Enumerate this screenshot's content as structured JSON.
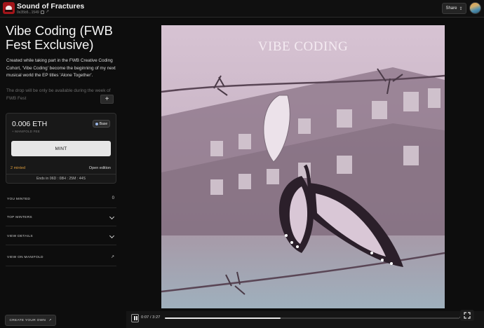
{
  "header": {
    "app_title": "Sound of Fractures",
    "address": "0x35b5...1549",
    "share_label": "Share"
  },
  "token": {
    "title": "Vibe Coding (FWB Fest Exclusive)",
    "description": "Created while taking part in the FWB Creative Coding Cohort, 'Vibe Coding' become the beginning of my next musical world the EP titles 'Alone Together'.",
    "description_more": "The drop will be only be available during the week of FWB Fest",
    "expand_label": "+"
  },
  "mint_card": {
    "price": "0.006 ETH",
    "fee_label": "+ MANIFOLD FEE",
    "chain": "Base",
    "mint_label": "MINT",
    "minted": "2 minted",
    "edition": "Open edition",
    "ends": "Ends in 06D : 08H : 25M : 44S"
  },
  "rows": {
    "you_minted": {
      "label": "YOU MINTED",
      "value": "0"
    },
    "top_minters": {
      "label": "TOP MINTERS"
    },
    "view_details": {
      "label": "VIEW DETAILS"
    },
    "view_manifold": {
      "label": "VIEW ON MANIFOLD"
    }
  },
  "footer": {
    "create_label": "CREATE YOUR OWN"
  },
  "artwork": {
    "title": "VIBE CODING"
  },
  "player": {
    "time": "0:07 / 3:27",
    "progress": 0.393
  },
  "colors": {
    "accent_minted": "#d99a3c",
    "mint_button": "#e6e6e6",
    "chain_dot": "#9ab6e8"
  },
  "icons": [
    "logo",
    "copy-icon",
    "external-link-icon",
    "share-icon",
    "chain-dot-icon",
    "chevron-down-icon",
    "arrow-up-right-icon",
    "pause-icon",
    "volume-icon",
    "fullscreen-icon"
  ]
}
